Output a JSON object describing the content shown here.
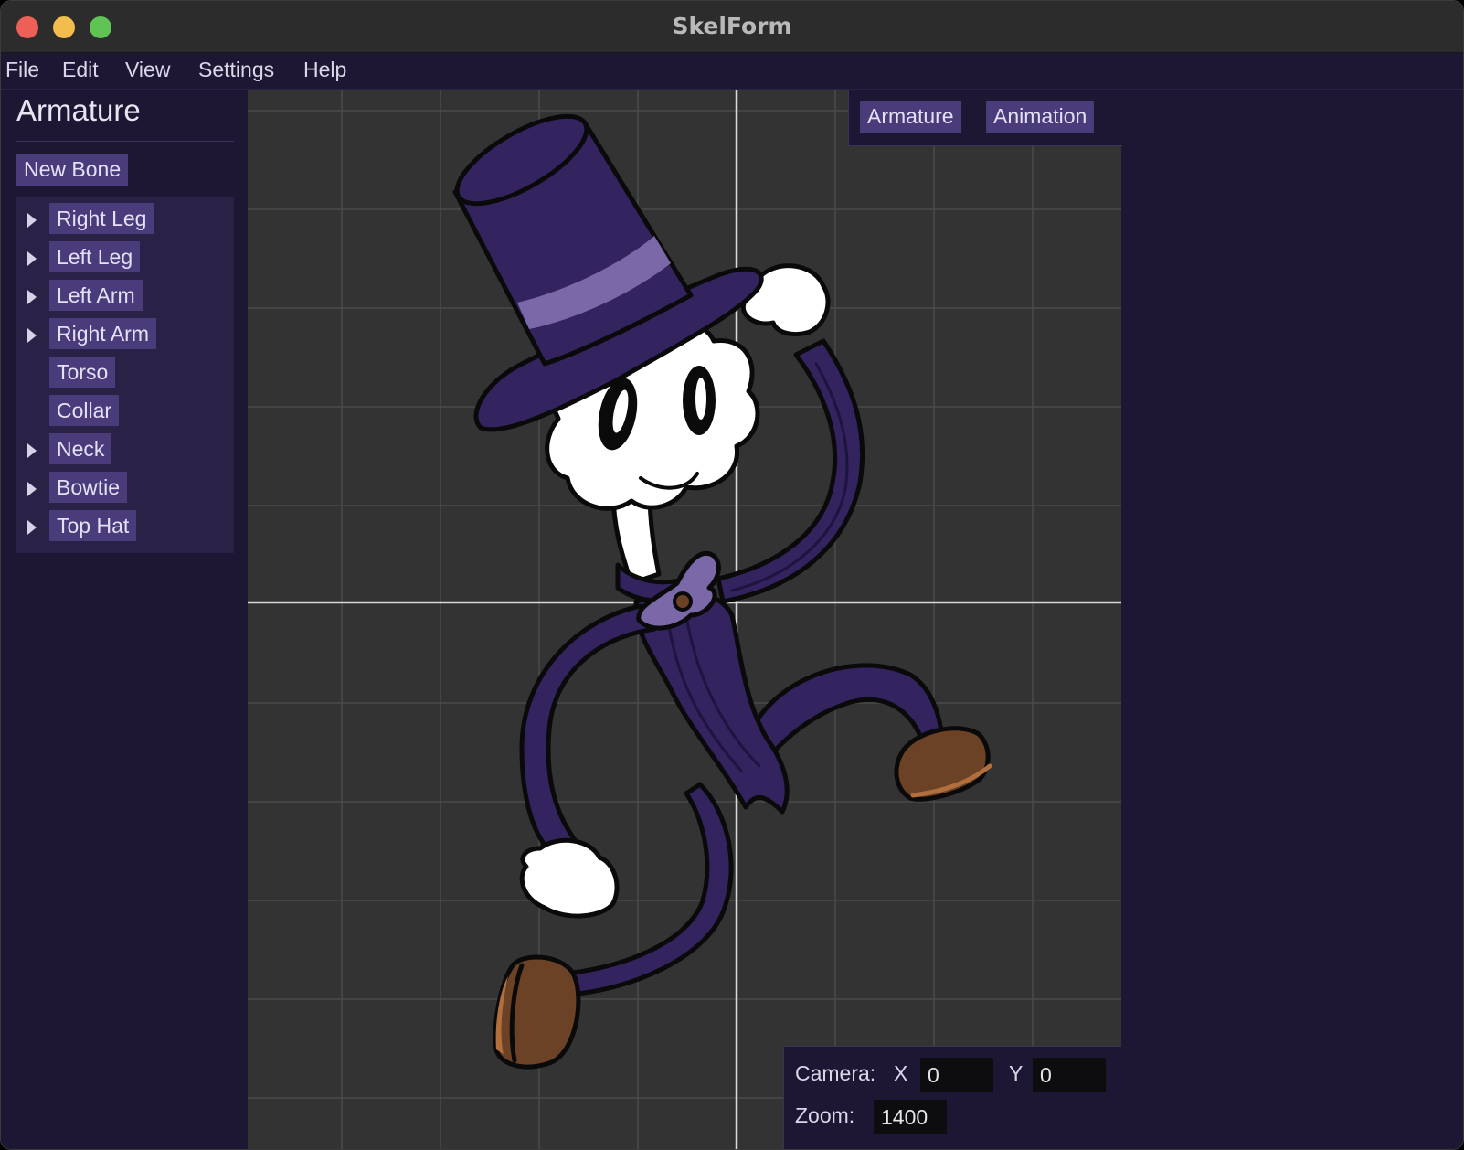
{
  "window": {
    "title": "SkelForm"
  },
  "menu": [
    "File",
    "Edit",
    "View",
    "Settings",
    "Help"
  ],
  "sidebar": {
    "title": "Armature",
    "new_bone_label": "New Bone",
    "bones": [
      {
        "label": "Right Leg",
        "expandable": true
      },
      {
        "label": "Left Leg",
        "expandable": true
      },
      {
        "label": "Left Arm",
        "expandable": true
      },
      {
        "label": "Right Arm",
        "expandable": true
      },
      {
        "label": "Torso",
        "expandable": false
      },
      {
        "label": "Collar",
        "expandable": false
      },
      {
        "label": "Neck",
        "expandable": true
      },
      {
        "label": "Bowtie",
        "expandable": true
      },
      {
        "label": "Top Hat",
        "expandable": true
      }
    ]
  },
  "mode_tabs": {
    "armature": "Armature",
    "animation": "Animation"
  },
  "camera": {
    "camera_label": "Camera:",
    "x_label": "X",
    "x_value": "0",
    "y_label": "Y",
    "y_value": "0",
    "zoom_label": "Zoom:",
    "zoom_value": "1400"
  },
  "colors": {
    "suit": "#33235e",
    "suit_light": "#7a68a8",
    "shoe": "#6b4226",
    "accent_button": "#4a3b7b",
    "panel_bg": "#1e1733",
    "viewport_bg": "#333333"
  }
}
